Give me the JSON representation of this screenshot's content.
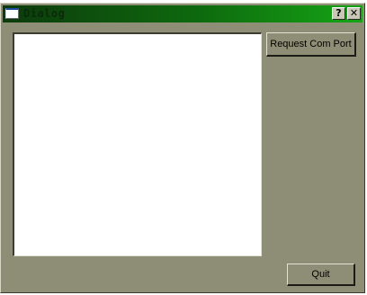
{
  "window": {
    "title": "Dialog",
    "title_icon": "window-icon",
    "help_glyph": "?",
    "close_glyph": "✕"
  },
  "buttons": {
    "request_com_port": "Request Com Port",
    "quit": "Quit"
  },
  "colors": {
    "titlebar_start": "#0c3a0c",
    "titlebar_end": "#15a515",
    "window_bg": "#8e8d76",
    "list_bg": "#ffffff"
  }
}
